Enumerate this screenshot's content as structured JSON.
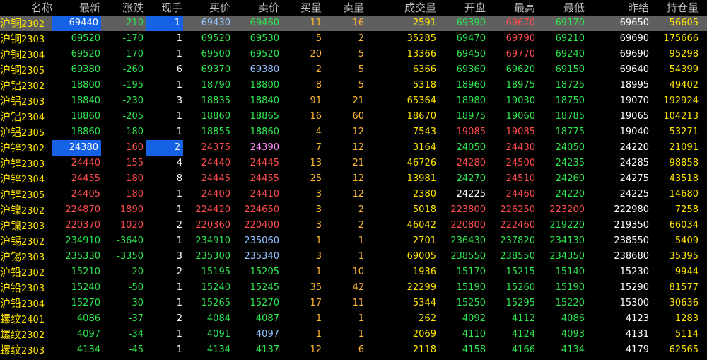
{
  "theme": {
    "background": "#000000",
    "selected_row": "#5f5f5f",
    "highlight_box": "#1662e6",
    "up": "#ff4d4d",
    "down": "#2ee64f",
    "neutral": "#ffffff",
    "volume": "#ffe600",
    "orders": "#ffb733"
  },
  "columns": [
    {
      "key": "name",
      "label": "名称"
    },
    {
      "key": "last",
      "label": "最新"
    },
    {
      "key": "change",
      "label": "涨跌"
    },
    {
      "key": "hand",
      "label": "现手"
    },
    {
      "key": "bid",
      "label": "买价"
    },
    {
      "key": "ask",
      "label": "卖价"
    },
    {
      "key": "bid_qty",
      "label": "买量"
    },
    {
      "key": "ask_qty",
      "label": "卖量"
    },
    {
      "key": "volume",
      "label": "成交量"
    },
    {
      "key": "open",
      "label": "开盘"
    },
    {
      "key": "high",
      "label": "最高"
    },
    {
      "key": "low",
      "label": "最低"
    },
    {
      "key": "prev_settle",
      "label": "昨结"
    },
    {
      "key": "open_interest",
      "label": "持仓量"
    }
  ],
  "rows": [
    {
      "name_cn": "沪铜",
      "code": "2302",
      "last": "69440",
      "change": "-210",
      "hand": "1",
      "bid": "69430",
      "ask": "69460",
      "bid_qty": "11",
      "ask_qty": "16",
      "volume": "2591",
      "open": "69390",
      "high": "69670",
      "low": "69170",
      "prev_settle": "69650",
      "open_interest": "56605",
      "colors": {
        "last": "white",
        "change": "green",
        "hand": "white",
        "bid": "lightblue",
        "ask": "green",
        "open": "green",
        "high": "red",
        "low": "green"
      },
      "selected": true,
      "boxed": [
        "last",
        "hand"
      ]
    },
    {
      "name_cn": "沪铜",
      "code": "2303",
      "last": "69520",
      "change": "-170",
      "hand": "1",
      "bid": "69520",
      "ask": "69530",
      "bid_qty": "5",
      "ask_qty": "2",
      "volume": "35285",
      "open": "69470",
      "high": "69790",
      "low": "69210",
      "prev_settle": "69690",
      "open_interest": "175666",
      "colors": {
        "last": "green",
        "change": "green",
        "hand": "white",
        "bid": "green",
        "ask": "green",
        "open": "green",
        "high": "red",
        "low": "green"
      }
    },
    {
      "name_cn": "沪铜",
      "code": "2304",
      "last": "69520",
      "change": "-170",
      "hand": "1",
      "bid": "69500",
      "ask": "69520",
      "bid_qty": "20",
      "ask_qty": "5",
      "volume": "13366",
      "open": "69450",
      "high": "69770",
      "low": "69240",
      "prev_settle": "69690",
      "open_interest": "95298",
      "colors": {
        "last": "green",
        "change": "green",
        "hand": "white",
        "bid": "green",
        "ask": "green",
        "open": "green",
        "high": "red",
        "low": "green"
      }
    },
    {
      "name_cn": "沪铜",
      "code": "2305",
      "last": "69380",
      "change": "-260",
      "hand": "6",
      "bid": "69370",
      "ask": "69380",
      "bid_qty": "2",
      "ask_qty": "5",
      "volume": "6366",
      "open": "69360",
      "high": "69620",
      "low": "69150",
      "prev_settle": "69640",
      "open_interest": "54399",
      "colors": {
        "last": "green",
        "change": "green",
        "hand": "white",
        "bid": "green",
        "ask": "lightblue",
        "open": "green",
        "high": "green",
        "low": "green"
      }
    },
    {
      "name_cn": "沪铝",
      "code": "2302",
      "last": "18800",
      "change": "-195",
      "hand": "1",
      "bid": "18790",
      "ask": "18800",
      "bid_qty": "8",
      "ask_qty": "5",
      "volume": "5318",
      "open": "18960",
      "high": "18975",
      "low": "18725",
      "prev_settle": "18995",
      "open_interest": "49402",
      "colors": {
        "last": "green",
        "change": "green",
        "hand": "white",
        "bid": "green",
        "ask": "green",
        "open": "green",
        "high": "green",
        "low": "green"
      }
    },
    {
      "name_cn": "沪铝",
      "code": "2303",
      "last": "18840",
      "change": "-230",
      "hand": "3",
      "bid": "18835",
      "ask": "18840",
      "bid_qty": "91",
      "ask_qty": "21",
      "volume": "65364",
      "open": "18980",
      "high": "19030",
      "low": "18750",
      "prev_settle": "19070",
      "open_interest": "192924",
      "colors": {
        "last": "green",
        "change": "green",
        "hand": "white",
        "bid": "green",
        "ask": "green",
        "open": "green",
        "high": "green",
        "low": "green"
      }
    },
    {
      "name_cn": "沪铝",
      "code": "2304",
      "last": "18860",
      "change": "-205",
      "hand": "1",
      "bid": "18860",
      "ask": "18865",
      "bid_qty": "16",
      "ask_qty": "60",
      "volume": "18670",
      "open": "18975",
      "high": "19060",
      "low": "18785",
      "prev_settle": "19065",
      "open_interest": "104213",
      "colors": {
        "last": "green",
        "change": "green",
        "hand": "white",
        "bid": "green",
        "ask": "green",
        "open": "green",
        "high": "green",
        "low": "green"
      }
    },
    {
      "name_cn": "沪铝",
      "code": "2305",
      "last": "18860",
      "change": "-180",
      "hand": "1",
      "bid": "18855",
      "ask": "18860",
      "bid_qty": "4",
      "ask_qty": "12",
      "volume": "7543",
      "open": "19085",
      "high": "19085",
      "low": "18775",
      "prev_settle": "19040",
      "open_interest": "53271",
      "colors": {
        "last": "green",
        "change": "green",
        "hand": "white",
        "bid": "green",
        "ask": "green",
        "open": "red",
        "high": "red",
        "low": "green"
      }
    },
    {
      "name_cn": "沪锌",
      "code": "2302",
      "last": "24380",
      "change": "160",
      "hand": "2",
      "bid": "24375",
      "ask": "24390",
      "bid_qty": "7",
      "ask_qty": "12",
      "volume": "3164",
      "open": "24050",
      "high": "24430",
      "low": "24050",
      "prev_settle": "24220",
      "open_interest": "21091",
      "colors": {
        "last": "white",
        "change": "red",
        "hand": "white",
        "bid": "red",
        "ask": "violet",
        "open": "green",
        "high": "red",
        "low": "green"
      },
      "boxed": [
        "last",
        "hand"
      ]
    },
    {
      "name_cn": "沪锌",
      "code": "2303",
      "last": "24440",
      "change": "155",
      "hand": "4",
      "bid": "24440",
      "ask": "24445",
      "bid_qty": "13",
      "ask_qty": "21",
      "volume": "46726",
      "open": "24280",
      "high": "24500",
      "low": "24235",
      "prev_settle": "24285",
      "open_interest": "98858",
      "colors": {
        "last": "red",
        "change": "red",
        "hand": "white",
        "bid": "red",
        "ask": "red",
        "open": "red",
        "high": "red",
        "low": "green"
      }
    },
    {
      "name_cn": "沪锌",
      "code": "2304",
      "last": "24455",
      "change": "180",
      "hand": "8",
      "bid": "24445",
      "ask": "24455",
      "bid_qty": "25",
      "ask_qty": "12",
      "volume": "13981",
      "open": "24270",
      "high": "24510",
      "low": "24260",
      "prev_settle": "24275",
      "open_interest": "43518",
      "colors": {
        "last": "red",
        "change": "red",
        "hand": "white",
        "bid": "red",
        "ask": "red",
        "open": "green",
        "high": "red",
        "low": "green"
      }
    },
    {
      "name_cn": "沪锌",
      "code": "2305",
      "last": "24405",
      "change": "180",
      "hand": "1",
      "bid": "24400",
      "ask": "24410",
      "bid_qty": "3",
      "ask_qty": "12",
      "volume": "2380",
      "open": "24225",
      "high": "24460",
      "low": "24220",
      "prev_settle": "24225",
      "open_interest": "14680",
      "colors": {
        "last": "red",
        "change": "red",
        "hand": "white",
        "bid": "red",
        "ask": "red",
        "open": "white",
        "high": "red",
        "low": "green"
      }
    },
    {
      "name_cn": "沪镍",
      "code": "2302",
      "last": "224870",
      "change": "1890",
      "hand": "1",
      "bid": "224420",
      "ask": "224650",
      "bid_qty": "3",
      "ask_qty": "2",
      "volume": "5018",
      "open": "223800",
      "high": "226250",
      "low": "223200",
      "prev_settle": "222980",
      "open_interest": "7258",
      "colors": {
        "last": "red",
        "change": "red",
        "hand": "white",
        "bid": "red",
        "ask": "red",
        "open": "red",
        "high": "red",
        "low": "red"
      }
    },
    {
      "name_cn": "沪镍",
      "code": "2303",
      "last": "220370",
      "change": "1020",
      "hand": "2",
      "bid": "220360",
      "ask": "220400",
      "bid_qty": "3",
      "ask_qty": "2",
      "volume": "46042",
      "open": "220800",
      "high": "222460",
      "low": "219220",
      "prev_settle": "219350",
      "open_interest": "66034",
      "colors": {
        "last": "red",
        "change": "red",
        "hand": "white",
        "bid": "red",
        "ask": "red",
        "open": "red",
        "high": "red",
        "low": "green"
      }
    },
    {
      "name_cn": "沪锡",
      "code": "2302",
      "last": "234910",
      "change": "-3640",
      "hand": "1",
      "bid": "234910",
      "ask": "235060",
      "bid_qty": "1",
      "ask_qty": "1",
      "volume": "2701",
      "open": "236430",
      "high": "237820",
      "low": "234130",
      "prev_settle": "238550",
      "open_interest": "5409",
      "colors": {
        "last": "green",
        "change": "green",
        "hand": "white",
        "bid": "green",
        "ask": "lightblue",
        "open": "green",
        "high": "green",
        "low": "green"
      }
    },
    {
      "name_cn": "沪锡",
      "code": "2303",
      "last": "235330",
      "change": "-3350",
      "hand": "3",
      "bid": "235300",
      "ask": "235340",
      "bid_qty": "3",
      "ask_qty": "1",
      "volume": "69005",
      "open": "238550",
      "high": "238550",
      "low": "234350",
      "prev_settle": "238680",
      "open_interest": "35395",
      "colors": {
        "last": "green",
        "change": "green",
        "hand": "white",
        "bid": "green",
        "ask": "lightblue",
        "open": "green",
        "high": "green",
        "low": "green"
      }
    },
    {
      "name_cn": "沪铅",
      "code": "2302",
      "last": "15210",
      "change": "-20",
      "hand": "2",
      "bid": "15195",
      "ask": "15205",
      "bid_qty": "1",
      "ask_qty": "10",
      "volume": "1936",
      "open": "15170",
      "high": "15215",
      "low": "15140",
      "prev_settle": "15230",
      "open_interest": "9944",
      "colors": {
        "last": "green",
        "change": "green",
        "hand": "white",
        "bid": "green",
        "ask": "green",
        "open": "green",
        "high": "green",
        "low": "green"
      }
    },
    {
      "name_cn": "沪铅",
      "code": "2303",
      "last": "15240",
      "change": "-50",
      "hand": "1",
      "bid": "15240",
      "ask": "15245",
      "bid_qty": "35",
      "ask_qty": "42",
      "volume": "22299",
      "open": "15190",
      "high": "15260",
      "low": "15190",
      "prev_settle": "15290",
      "open_interest": "81577",
      "colors": {
        "last": "green",
        "change": "green",
        "hand": "white",
        "bid": "green",
        "ask": "green",
        "open": "green",
        "high": "green",
        "low": "green"
      }
    },
    {
      "name_cn": "沪铅",
      "code": "2304",
      "last": "15270",
      "change": "-30",
      "hand": "1",
      "bid": "15265",
      "ask": "15270",
      "bid_qty": "17",
      "ask_qty": "11",
      "volume": "5344",
      "open": "15250",
      "high": "15295",
      "low": "15220",
      "prev_settle": "15300",
      "open_interest": "30636",
      "colors": {
        "last": "green",
        "change": "green",
        "hand": "white",
        "bid": "green",
        "ask": "green",
        "open": "green",
        "high": "green",
        "low": "green"
      }
    },
    {
      "name_cn": "螺纹",
      "code": "2401",
      "last": "4086",
      "change": "-37",
      "hand": "2",
      "bid": "4084",
      "ask": "4087",
      "bid_qty": "1",
      "ask_qty": "1",
      "volume": "262",
      "open": "4092",
      "high": "4112",
      "low": "4086",
      "prev_settle": "4123",
      "open_interest": "1283",
      "colors": {
        "last": "green",
        "change": "green",
        "hand": "white",
        "bid": "green",
        "ask": "green",
        "open": "green",
        "high": "green",
        "low": "green"
      }
    },
    {
      "name_cn": "螺纹",
      "code": "2302",
      "last": "4097",
      "change": "-34",
      "hand": "1",
      "bid": "4091",
      "ask": "4097",
      "bid_qty": "1",
      "ask_qty": "1",
      "volume": "2069",
      "open": "4110",
      "high": "4124",
      "low": "4093",
      "prev_settle": "4131",
      "open_interest": "5114",
      "colors": {
        "last": "green",
        "change": "green",
        "hand": "white",
        "bid": "green",
        "ask": "lightblue",
        "open": "green",
        "high": "green",
        "low": "green"
      }
    },
    {
      "name_cn": "螺纹",
      "code": "2303",
      "last": "4134",
      "change": "-45",
      "hand": "1",
      "bid": "4134",
      "ask": "4137",
      "bid_qty": "12",
      "ask_qty": "6",
      "volume": "2118",
      "open": "4158",
      "high": "4166",
      "low": "4134",
      "prev_settle": "4179",
      "open_interest": "62565",
      "colors": {
        "last": "green",
        "change": "green",
        "hand": "white",
        "bid": "green",
        "ask": "green",
        "open": "green",
        "high": "green",
        "low": "green"
      }
    }
  ]
}
